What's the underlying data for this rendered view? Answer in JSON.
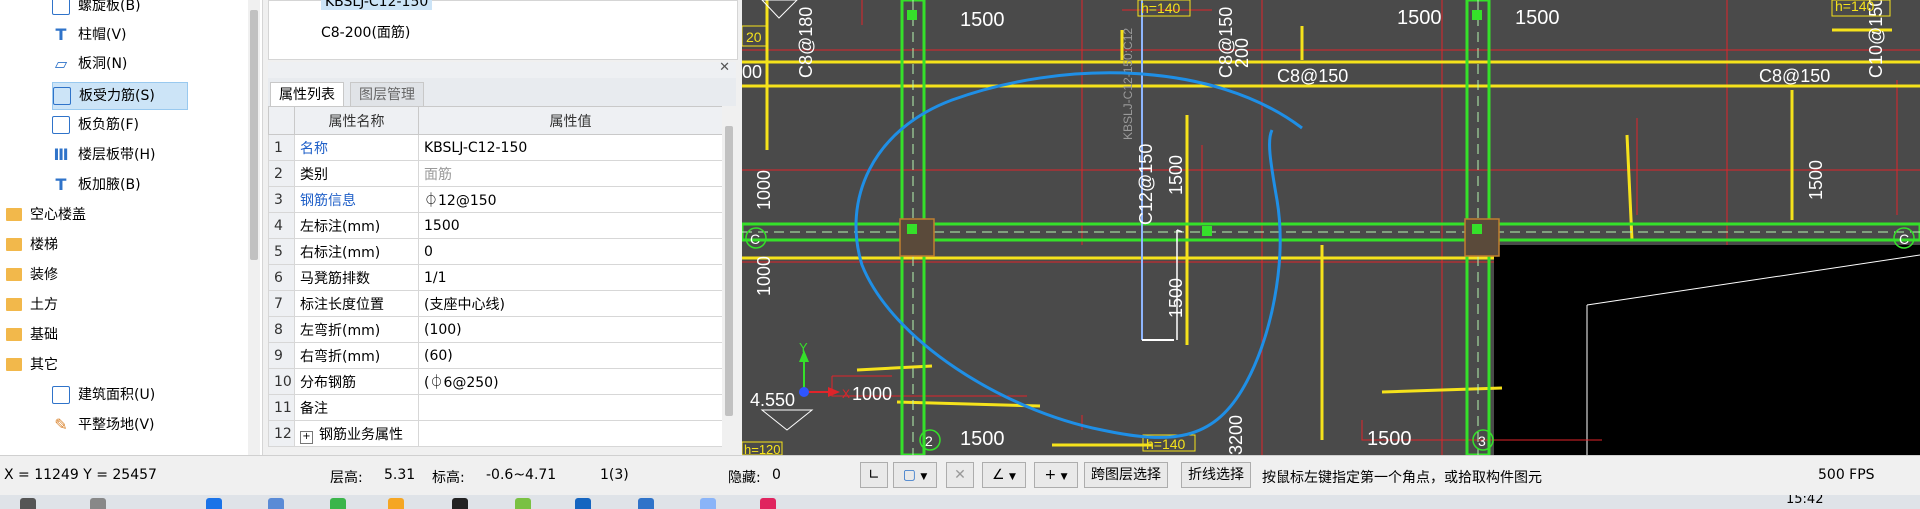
{
  "tree": {
    "items": [
      {
        "label": "螺旋板(B)",
        "icon": "spiral-slab-icon"
      },
      {
        "label": "柱帽(V)",
        "icon": "column-cap-icon"
      },
      {
        "label": "板洞(N)",
        "icon": "slab-hole-icon"
      },
      {
        "label": "板受力筋(S)",
        "icon": "slab-stress-rebar-icon"
      },
      {
        "label": "板负筋(F)",
        "icon": "slab-negative-rebar-icon"
      },
      {
        "label": "楼层板带(H)",
        "icon": "floor-strip-icon"
      },
      {
        "label": "板加腋(B)",
        "icon": "slab-haunch-icon"
      }
    ],
    "folders": [
      {
        "label": "空心楼盖"
      },
      {
        "label": "楼梯"
      },
      {
        "label": "装修"
      },
      {
        "label": "土方"
      },
      {
        "label": "基础"
      },
      {
        "label": "其它"
      }
    ],
    "other_items": [
      {
        "label": "建筑面积(U)",
        "icon": "building-area-icon"
      },
      {
        "label": "平整场地(V)",
        "icon": "site-leveling-icon"
      }
    ]
  },
  "component_list": {
    "items": [
      "KBSLJ-C12-150",
      "C8-200(面筋)"
    ]
  },
  "panel": {
    "tabs": [
      "属性列表",
      "图层管理"
    ],
    "columns": [
      "属性名称",
      "属性值"
    ],
    "rows": [
      {
        "no": "1",
        "name": "名称",
        "value": "KBSLJ-C12-150"
      },
      {
        "no": "2",
        "name": "类别",
        "value": "面筋"
      },
      {
        "no": "3",
        "name": "钢筋信息",
        "value": "⏀12@150"
      },
      {
        "no": "4",
        "name": "左标注(mm)",
        "value": "1500"
      },
      {
        "no": "5",
        "name": "右标注(mm)",
        "value": "0"
      },
      {
        "no": "6",
        "name": "马凳筋排数",
        "value": "1/1"
      },
      {
        "no": "7",
        "name": "标注长度位置",
        "value": "(支座中心线)"
      },
      {
        "no": "8",
        "name": "左弯折(mm)",
        "value": "(100)"
      },
      {
        "no": "9",
        "name": "右弯折(mm)",
        "value": "(60)"
      },
      {
        "no": "10",
        "name": "分布钢筋",
        "value": "(⏀6@250)"
      },
      {
        "no": "11",
        "name": "备注",
        "value": ""
      },
      {
        "no": "12",
        "name": "钢筋业务属性",
        "value": ""
      }
    ]
  },
  "cad": {
    "labels": {
      "dim_1500": "1500",
      "dim_1000": "1000",
      "dim_4550": "4.550",
      "dim_200": "200",
      "dim_00": "00",
      "rebar_c8_180": "C8@180",
      "rebar_c8_150": "C8@150",
      "rebar_c12_150": "C12@150",
      "rebar_c10_150": "C10@150",
      "kbslj": "KBSLJ-C12-150:C12",
      "h140": "h=140",
      "h120": "h=120",
      "axis_c": "C",
      "axis_2": "2",
      "axis_3": "3",
      "axis_x": "X",
      "axis_y": "Y",
      "dim_3200": "3200",
      "dim_20": "20"
    }
  },
  "status": {
    "coords": "X = 11249 Y = 25457",
    "floor_height": "层高:",
    "floor_height_val": "5.31",
    "elev": "标高:",
    "elev_val": "-0.6~4.71",
    "count": "1(3)",
    "hidden": "隐藏:",
    "hidden_val": "0",
    "cross_layer": "跨图层选择",
    "polyline_select": "折线选择",
    "hint": "按鼠标左键指定第一个角点，或拾取构件图元",
    "fps": "500 FPS"
  },
  "taskbar": {
    "time": "15:42"
  }
}
